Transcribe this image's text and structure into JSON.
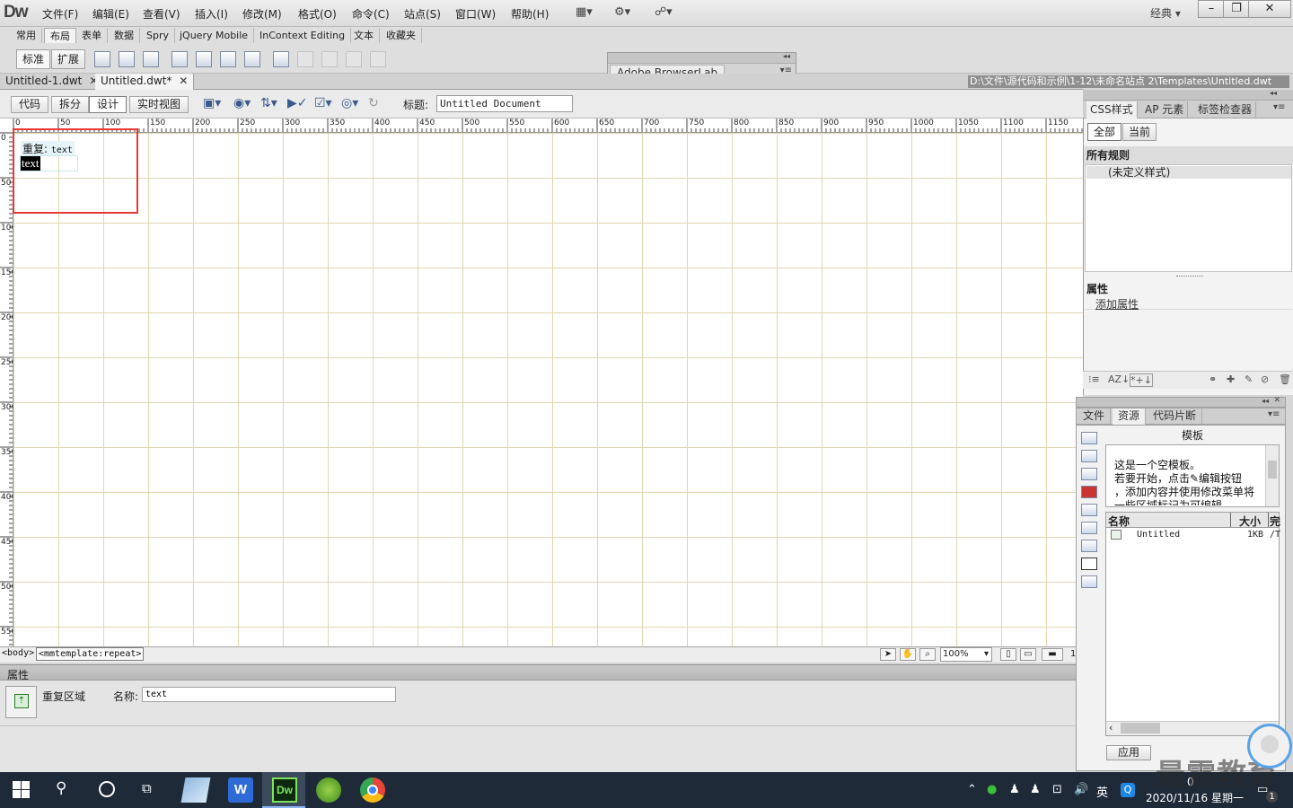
{
  "app": {
    "logo": "Dw",
    "mode": "经典 ▾"
  },
  "menu": [
    "文件(F)",
    "编辑(E)",
    "查看(V)",
    "插入(I)",
    "修改(M)",
    "格式(O)",
    "命令(C)",
    "站点(S)",
    "窗口(W)",
    "帮助(H)"
  ],
  "insert_tabs": [
    "常用",
    "布局",
    "表单",
    "数据",
    "Spry",
    "jQuery Mobile",
    "InContext Editing",
    "文本",
    "收藏夹"
  ],
  "insert_buttons": {
    "standard": "标准",
    "expanded": "扩展"
  },
  "browserlab": {
    "label": "Adobe BrowserLab"
  },
  "doc_tabs": [
    {
      "label": "Untitled-1.dwt"
    },
    {
      "label": "Untitled.dwt*"
    }
  ],
  "doc_path": "D:\\文件\\源代码和示例\\1-12\\未命名站点 2\\Templates\\Untitled.dwt",
  "views": [
    "代码",
    "拆分",
    "设计",
    "实时视图"
  ],
  "title": {
    "label": "标题:",
    "value": "Untitled Document"
  },
  "ruler_labels": [
    "0",
    "50",
    "100",
    "150",
    "200",
    "250",
    "300",
    "350",
    "400",
    "450",
    "500",
    "550",
    "600",
    "650",
    "700",
    "750",
    "800",
    "850",
    "900",
    "950",
    "1000",
    "1050",
    "1100",
    "1150"
  ],
  "ruler_v_labels": [
    "0",
    "50",
    "100",
    "150",
    "200",
    "250",
    "300",
    "350",
    "400",
    "450",
    "500",
    "550"
  ],
  "design": {
    "repeat_prefix": "重复:",
    "repeat_name": "text",
    "content_text": "text"
  },
  "status": {
    "tag_body": "<body>",
    "tag_repeat": "<mmtemplate:repeat>",
    "zoom": "100%",
    "suffix": "1"
  },
  "properties": {
    "title": "属性",
    "type": "重复区域",
    "name_label": "名称",
    "name_value": "text"
  },
  "css_panel": {
    "tabs": [
      "CSS样式",
      "AP 元素",
      "标签检查器"
    ],
    "segments": [
      "全部",
      "当前"
    ],
    "rules_header": "所有规则",
    "rule_item": "(未定义样式)",
    "attr_header": "属性",
    "attr_add": "添加属性"
  },
  "assets_panel": {
    "tabs": [
      "文件",
      "资源",
      "代码片断"
    ],
    "template_title": "模板",
    "preview_lines": [
      "这是一个空模板。",
      "若要开始，点击✎编辑按钮",
      "，添加内容并使用修改菜单将",
      "一些区域标记为可编辑。"
    ],
    "col_name": "名称",
    "col_size": "大小",
    "col_extra": "完",
    "item_name": "Untitled",
    "item_size": "1KB",
    "item_extra": "/T",
    "apply": "应用"
  },
  "taskbar": {
    "clock_time": "0",
    "clock_date": "2020/11/16 星期一",
    "ime": "英",
    "badge": "1"
  },
  "watermark": "最需教育",
  "colors": {
    "highlight": "#e53935",
    "grid": "#ded7b2",
    "taskbar": "#1f2a38"
  }
}
